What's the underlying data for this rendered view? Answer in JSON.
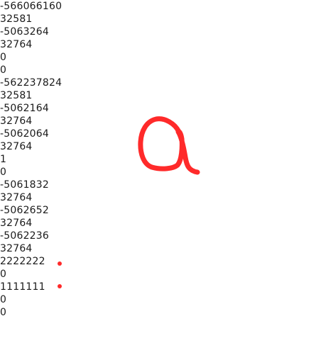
{
  "values": [
    "-566066160",
    "32581",
    "-5063264",
    "32764",
    "0",
    "0",
    "-562237824",
    "32581",
    "-5062164",
    "32764",
    "-5062064",
    "32764",
    "1",
    "0",
    "-5061832",
    "32764",
    "-5062652",
    "32764",
    "-5062236",
    "32764",
    "2222222",
    "0",
    "1111111",
    "0",
    "0"
  ],
  "annotation": {
    "color": "#ff2a2a",
    "glyph": "a",
    "marked_values": [
      "2222222",
      "1111111"
    ]
  }
}
